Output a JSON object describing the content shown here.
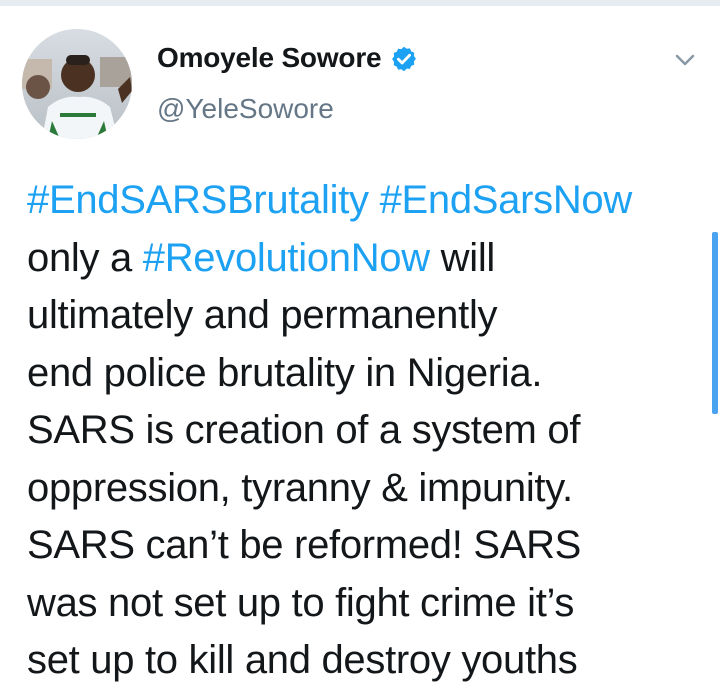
{
  "author": {
    "display_name": "Omoyele Sowore",
    "handle": "@YeleSowore",
    "verified": true,
    "avatar_icon": "profile-photo"
  },
  "tweet": {
    "line1": {
      "tag1": "#EndSARSBrutality",
      "space": " ",
      "tag2": "#EndSarsNow"
    },
    "line2": {
      "before": "only a ",
      "tag": "#RevolutionNow",
      "after": " will"
    },
    "line3": "ultimately and permanently",
    "line4": "end police brutality in Nigeria.",
    "line5": "SARS is creation of a system of",
    "line6": "oppression, tyranny & impunity.",
    "line7": "SARS can’t be reformed! SARS",
    "line8": "was not set up to fight crime it’s",
    "line9": "set up to kill and destroy youths"
  },
  "colors": {
    "hashtag": "#1da1f2",
    "text": "#14171a",
    "secondary": "#657786",
    "verified": "#1da1f2"
  },
  "icons": {
    "menu": "chevron-down-icon",
    "verified": "verified-badge-icon"
  }
}
